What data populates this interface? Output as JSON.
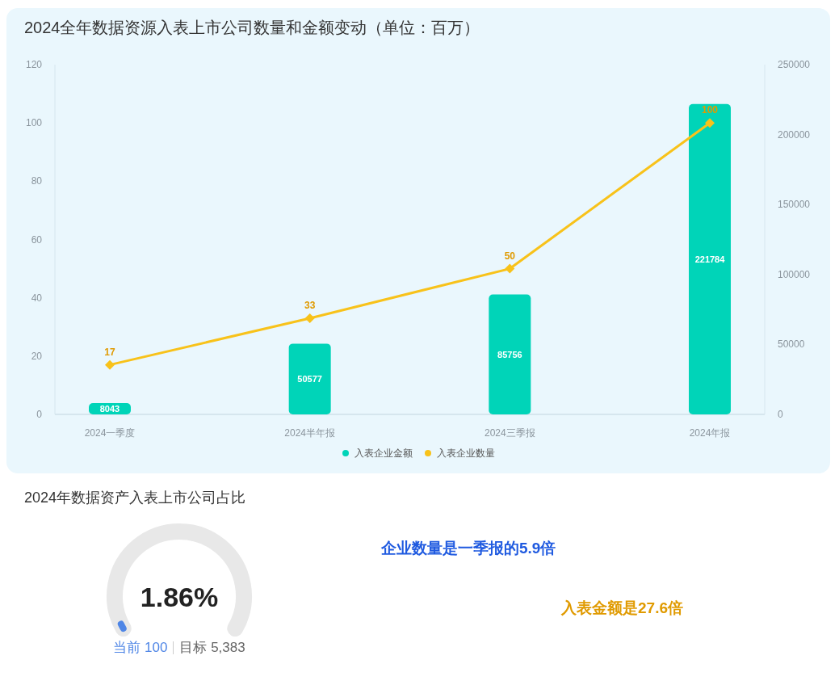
{
  "chart_panel": {
    "title": "2024全年数据资源入表上市公司数量和金额变动（单位：百万）",
    "chart_data": {
      "type": "bar",
      "categories": [
        "2024一季度",
        "2024半年报",
        "2024三季报",
        "2024年报"
      ],
      "series": [
        {
          "name": "入表企业金额",
          "color": "#00d4b8",
          "axis": "y2",
          "values": [
            8043,
            50577,
            85756,
            221784
          ]
        },
        {
          "name": "入表企业数量",
          "color": "#f8c21a",
          "type": "line",
          "marker": "diamond",
          "values": [
            17,
            33,
            50,
            100
          ]
        }
      ],
      "ylim": [
        0,
        120
      ],
      "yticks": [
        0,
        20,
        40,
        60,
        80,
        100,
        120
      ],
      "y2lim": [
        0,
        250000
      ],
      "y2ticks": [
        0,
        50000,
        100000,
        150000,
        200000,
        250000
      ],
      "data_labels": true,
      "legend": "bottom"
    }
  },
  "share_panel": {
    "title": "2024年数据资产入表上市公司占比",
    "gauge": {
      "value": "1.86%",
      "level": 0.0186,
      "current_label": "当前",
      "current": "100",
      "target_label": "目标",
      "target": "5,383"
    },
    "notes": [
      {
        "text": "企业数量是一季报的5.9倍",
        "color": "#1f5ae0"
      },
      {
        "text": "入表金额是27.6倍",
        "color": "#e09a00"
      }
    ]
  }
}
